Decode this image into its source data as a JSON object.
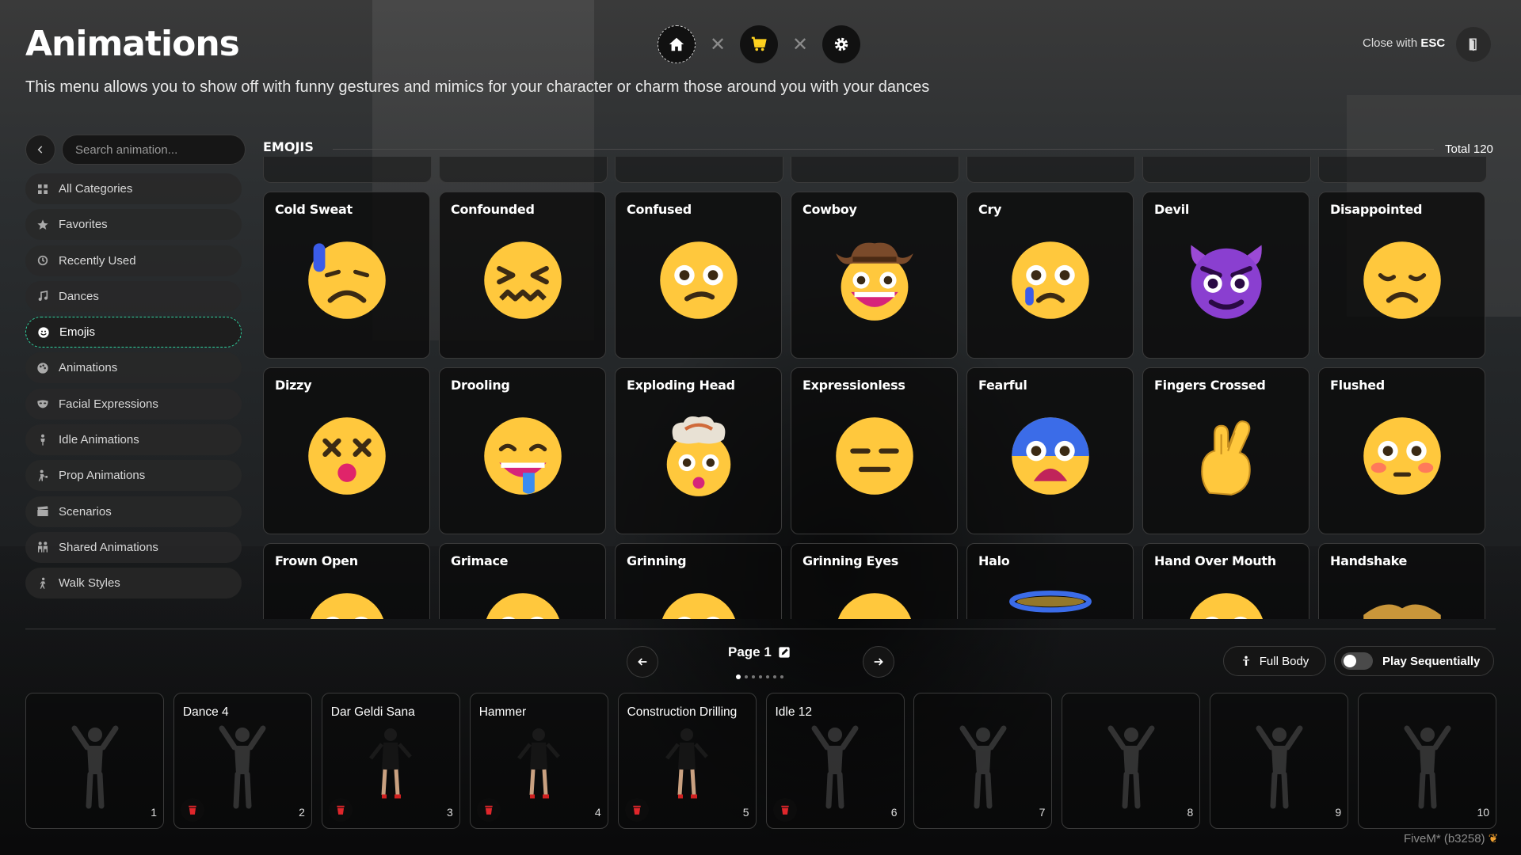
{
  "header": {
    "title": "Animations",
    "subtitle": "This menu allows you to show off with funny gestures and mimics for your character or charm those around you with your dances",
    "close_hint_prefix": "Close with ",
    "close_hint_key": "ESC"
  },
  "topnav": [
    "home-icon",
    "cart-icon",
    "gear-icon"
  ],
  "sidebar": {
    "search_placeholder": "Search animation...",
    "items": [
      {
        "label": "All Categories",
        "icon": "grid-icon"
      },
      {
        "label": "Favorites",
        "icon": "star-icon"
      },
      {
        "label": "Recently Used",
        "icon": "history-icon"
      },
      {
        "label": "Dances",
        "icon": "music-note-icon"
      },
      {
        "label": "Emojis",
        "icon": "smiley-icon",
        "active": true
      },
      {
        "label": "Animations",
        "icon": "palette-icon"
      },
      {
        "label": "Facial Expressions",
        "icon": "mask-icon"
      },
      {
        "label": "Idle Animations",
        "icon": "person-standing-icon"
      },
      {
        "label": "Prop Animations",
        "icon": "person-prop-icon"
      },
      {
        "label": "Scenarios",
        "icon": "clapperboard-icon"
      },
      {
        "label": "Shared Animations",
        "icon": "people-icon"
      },
      {
        "label": "Walk Styles",
        "icon": "person-walking-icon"
      }
    ]
  },
  "section": {
    "title": "EMOJIS",
    "total": "Total 120"
  },
  "emojis": [
    {
      "label": "Cold Sweat",
      "icon": "cold-sweat-emoji"
    },
    {
      "label": "Confounded",
      "icon": "confounded-emoji"
    },
    {
      "label": "Confused",
      "icon": "confused-emoji"
    },
    {
      "label": "Cowboy",
      "icon": "cowboy-emoji"
    },
    {
      "label": "Cry",
      "icon": "cry-emoji"
    },
    {
      "label": "Devil",
      "icon": "devil-emoji"
    },
    {
      "label": "Disappointed",
      "icon": "disappointed-emoji"
    },
    {
      "label": "Dizzy",
      "icon": "dizzy-emoji"
    },
    {
      "label": "Drooling",
      "icon": "drooling-emoji"
    },
    {
      "label": "Exploding Head",
      "icon": "exploding-head-emoji"
    },
    {
      "label": "Expressionless",
      "icon": "expressionless-emoji"
    },
    {
      "label": "Fearful",
      "icon": "fearful-emoji"
    },
    {
      "label": "Fingers Crossed",
      "icon": "fingers-crossed-emoji"
    },
    {
      "label": "Flushed",
      "icon": "flushed-emoji"
    },
    {
      "label": "Frown Open",
      "icon": "frown-open-emoji"
    },
    {
      "label": "Grimace",
      "icon": "grimace-emoji"
    },
    {
      "label": "Grinning",
      "icon": "grinning-emoji"
    },
    {
      "label": "Grinning Eyes",
      "icon": "grinning-eyes-emoji"
    },
    {
      "label": "Halo",
      "icon": "halo-emoji"
    },
    {
      "label": "Hand Over Mouth",
      "icon": "hand-over-mouth-emoji"
    },
    {
      "label": "Handshake",
      "icon": "handshake-emoji"
    }
  ],
  "pagination": {
    "label": "Page 1",
    "pages": 7,
    "current": 1
  },
  "controls": {
    "full_body": "Full Body",
    "play_sequentially": "Play Sequentially",
    "play_sequentially_on": false
  },
  "slots": [
    {
      "number": "1",
      "name": "",
      "filled": false
    },
    {
      "number": "2",
      "name": "Dance 4",
      "filled": true
    },
    {
      "number": "3",
      "name": "Dar Geldi Sana",
      "filled": true
    },
    {
      "number": "4",
      "name": "Hammer",
      "filled": true
    },
    {
      "number": "5",
      "name": "Construction Drilling",
      "filled": true
    },
    {
      "number": "6",
      "name": "Idle 12",
      "filled": true
    },
    {
      "number": "7",
      "name": "",
      "filled": false
    },
    {
      "number": "8",
      "name": "",
      "filled": false
    },
    {
      "number": "9",
      "name": "",
      "filled": false
    },
    {
      "number": "10",
      "name": "",
      "filled": false
    }
  ],
  "footer": {
    "build": "FiveM* (b3258)"
  },
  "colors": {
    "accent": "#2fd4a0",
    "emoji_yellow": "#ffc83d",
    "danger": "#e0262b"
  }
}
